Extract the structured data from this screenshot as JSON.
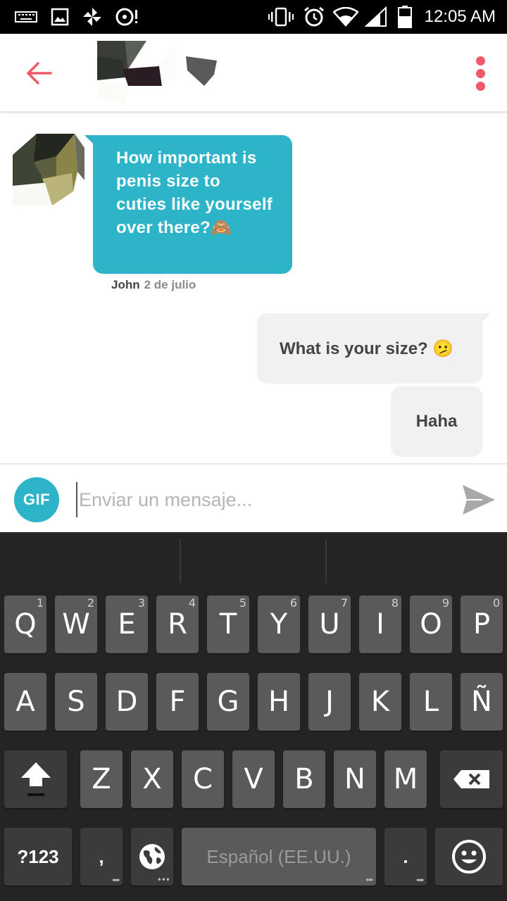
{
  "status_bar": {
    "time": "12:05 AM",
    "left_icons": [
      "keyboard-icon",
      "image-icon",
      "pinwheel-icon",
      "disc-alert-icon"
    ],
    "right_icons": [
      "vibrate-icon",
      "alarm-icon",
      "wifi-icon",
      "signal-icon",
      "battery-icon"
    ]
  },
  "header": {
    "back_icon": "arrow-left-icon",
    "menu_icon": "more-vert-icon",
    "accent_color": "#f05a66"
  },
  "messages": {
    "incoming": {
      "text": "How important is penis size to cuties like yourself over there?🙈",
      "sender": "John",
      "date": "2 de julio"
    },
    "outgoing": [
      {
        "text": "What is your size? 🫤"
      },
      {
        "text": "Haha"
      }
    ],
    "bubble_color": "#2db4c8"
  },
  "composer": {
    "gif_label": "GIF",
    "placeholder": "Enviar un mensaje...",
    "send_icon": "send-icon"
  },
  "keyboard": {
    "row1": [
      "Q",
      "W",
      "E",
      "R",
      "T",
      "Y",
      "U",
      "I",
      "O",
      "P"
    ],
    "row1_hints": [
      "1",
      "2",
      "3",
      "4",
      "5",
      "6",
      "7",
      "8",
      "9",
      "0"
    ],
    "row2": [
      "A",
      "S",
      "D",
      "F",
      "G",
      "H",
      "J",
      "K",
      "L",
      "Ñ"
    ],
    "row3": [
      "Z",
      "X",
      "C",
      "V",
      "B",
      "N",
      "M"
    ],
    "symbols_label": "?123",
    "comma_label": ",",
    "space_label": "Español (EE.UU.)",
    "period_label": ".",
    "shift_icon": "shift-icon",
    "backspace_icon": "backspace-icon",
    "globe_icon": "globe-icon",
    "emoji_icon": "emoji-icon"
  }
}
